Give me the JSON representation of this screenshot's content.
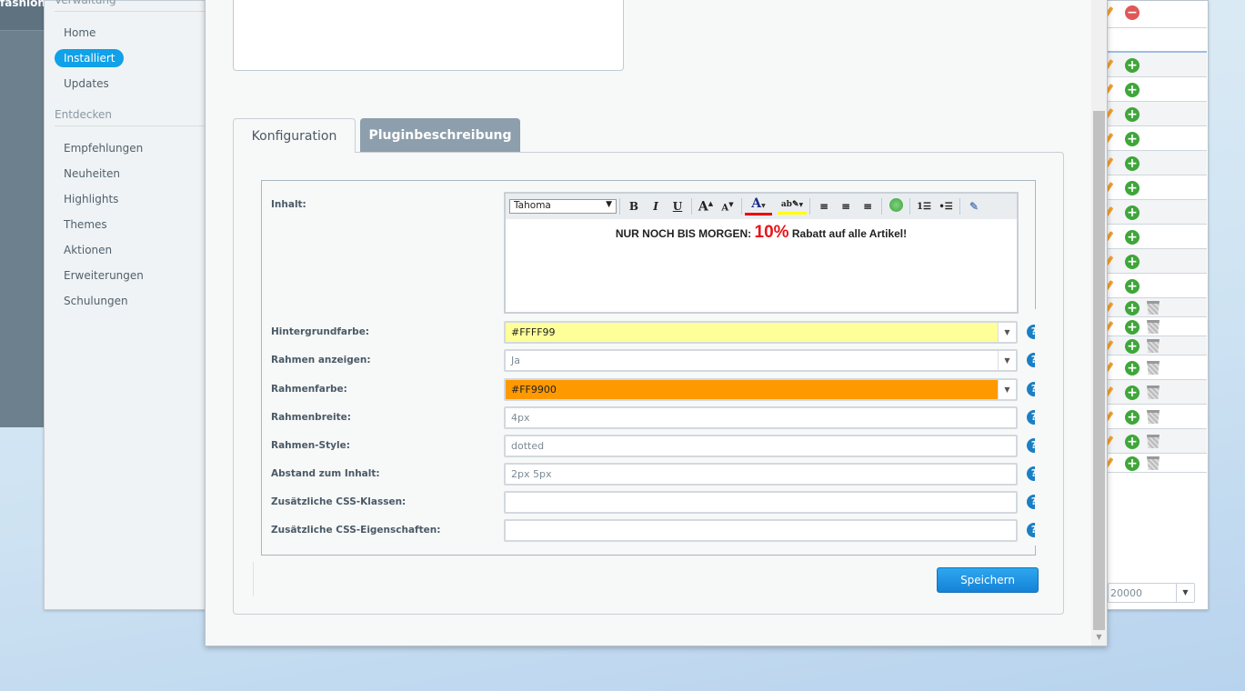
{
  "background_app": {
    "shop_name": "fashion S"
  },
  "sidebar": {
    "sections": [
      {
        "label": "Verwaltung"
      },
      {
        "label": "Entdecken"
      }
    ],
    "items": [
      {
        "label": "Home"
      },
      {
        "label": "Installiert",
        "active": true
      },
      {
        "label": "Updates"
      },
      {
        "label": "Empfehlungen"
      },
      {
        "label": "Neuheiten"
      },
      {
        "label": "Highlights"
      },
      {
        "label": "Themes"
      },
      {
        "label": "Aktionen"
      },
      {
        "label": "Erweiterungen"
      },
      {
        "label": "Schulungen"
      }
    ]
  },
  "right_table": {
    "pager_value": "20000",
    "accent_add": "#3fa63a",
    "accent_remove": "#e05757"
  },
  "modal": {
    "tabs": [
      {
        "label": "Konfiguration",
        "active": true
      },
      {
        "label": "Pluginbeschreibung"
      }
    ],
    "editor": {
      "label": "Inhalt:",
      "font": "Tahoma",
      "content_prefix": "NUR NOCH BIS MORGEN: ",
      "content_highlight": "10%",
      "content_suffix": " Rabatt auf alle Artikel!",
      "highlight_color": "#e8141b"
    },
    "fields": [
      {
        "label": "Hintergrundfarbe:",
        "value": "#FFFF99",
        "type": "color-select",
        "bg": "#FFFF99"
      },
      {
        "label": "Rahmen anzeigen:",
        "value": "Ja",
        "type": "select"
      },
      {
        "label": "Rahmenfarbe:",
        "value": "#FF9900",
        "type": "color-select",
        "bg": "#FF9900"
      },
      {
        "label": "Rahmenbreite:",
        "value": "4px",
        "type": "text"
      },
      {
        "label": "Rahmen-Style:",
        "value": "dotted",
        "type": "text"
      },
      {
        "label": "Abstand zum Inhalt:",
        "value": "2px 5px",
        "type": "text"
      },
      {
        "label": "Zusätzliche CSS-Klassen:",
        "value": "",
        "type": "text"
      },
      {
        "label": "Zusätzliche CSS-Eigenschaften:",
        "value": "",
        "type": "text"
      }
    ],
    "help_glyph": "?",
    "save_label": "Speichern"
  }
}
